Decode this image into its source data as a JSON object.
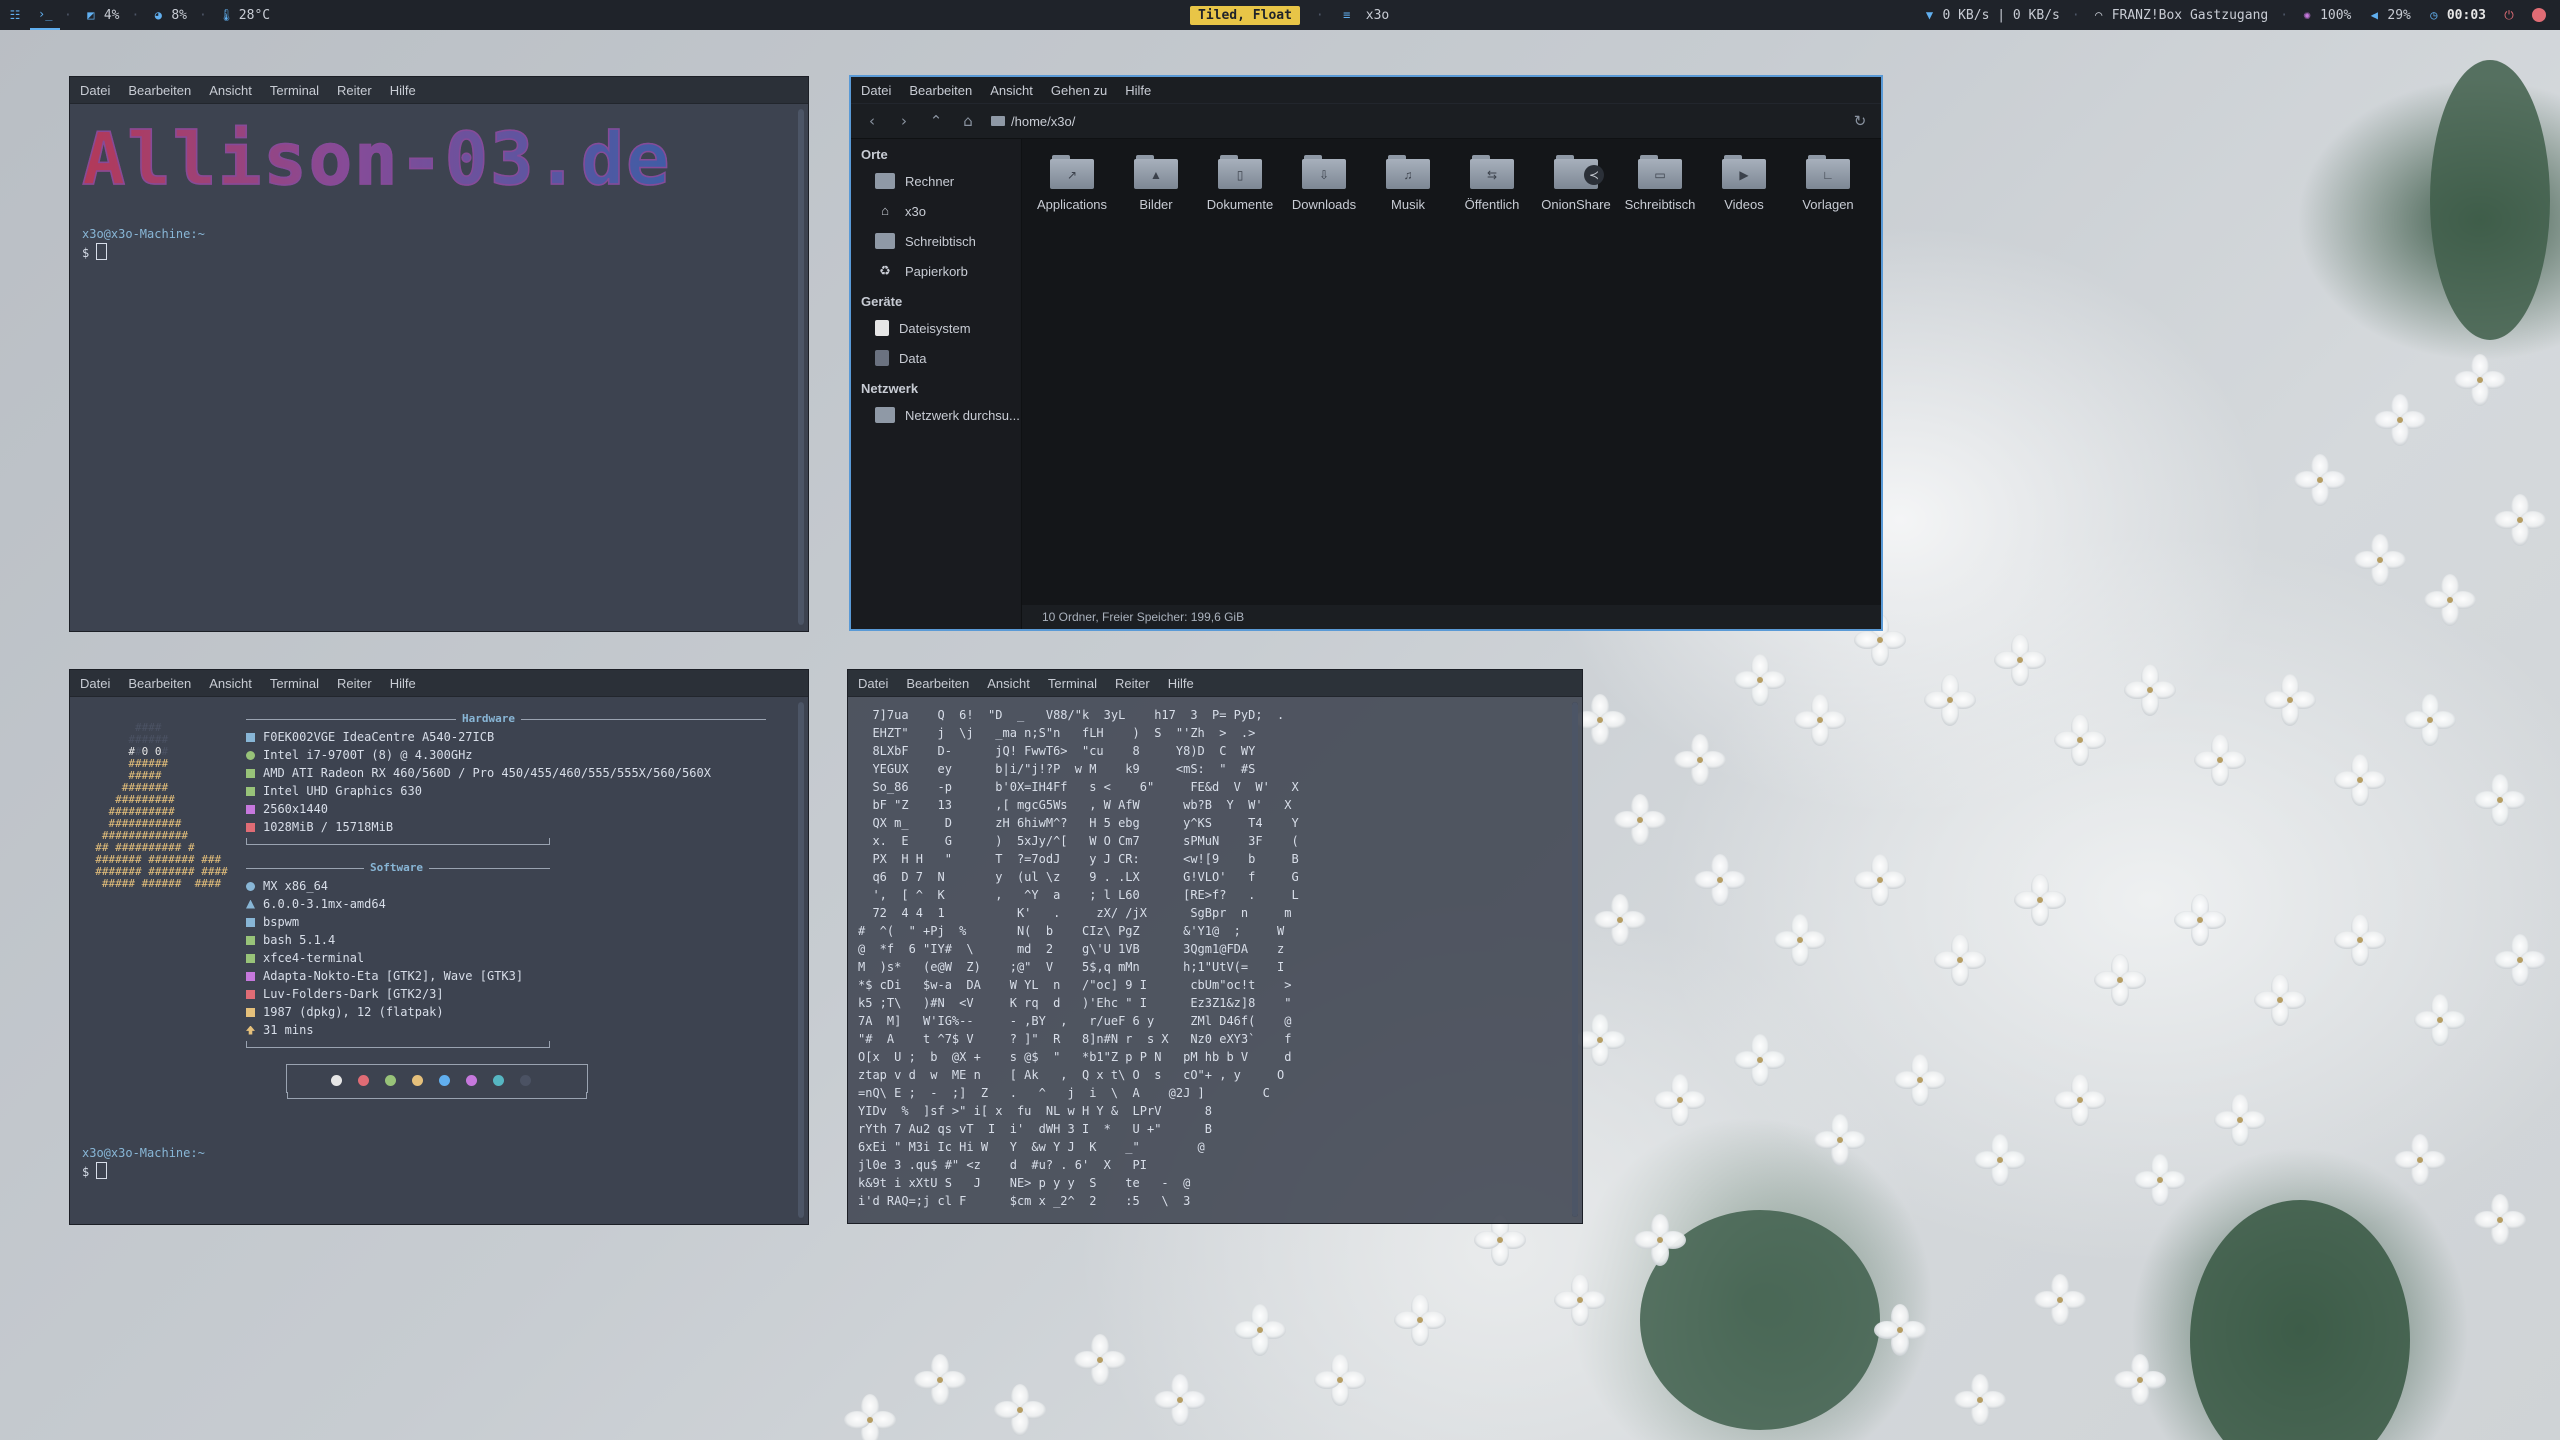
{
  "topbar": {
    "cpu": "4%",
    "ram": "8%",
    "temp": "28°C",
    "mode": "Tiled, Float",
    "window_title": "x3o",
    "net": "0 KB/s | 0 KB/s",
    "wifi": "FRANZ!Box Gastzugang",
    "brightness": "100%",
    "volume": "29%",
    "clock": "00:03"
  },
  "menu": [
    "Datei",
    "Bearbeiten",
    "Ansicht",
    "Terminal",
    "Reiter",
    "Hilfe"
  ],
  "fm_menu": [
    "Datei",
    "Bearbeiten",
    "Ansicht",
    "Gehen zu",
    "Hilfe"
  ],
  "term1": {
    "banner": "Allison-03.de",
    "prompt": "x3o@x3o-Machine:~",
    "ps": "$"
  },
  "filemanager": {
    "path": "/home/x3o/",
    "sections": [
      {
        "title": "Orte",
        "items": [
          "Rechner",
          "x3o",
          "Schreibtisch",
          "Papierkorb"
        ]
      },
      {
        "title": "Geräte",
        "items": [
          "Dateisystem",
          "Data"
        ]
      },
      {
        "title": "Netzwerk",
        "items": [
          "Netzwerk durchsu..."
        ]
      }
    ],
    "folders": [
      "Applications",
      "Bilder",
      "Dokumente",
      "Downloads",
      "Musik",
      "Öffentlich",
      "OnionShare",
      "Schreibtisch",
      "Videos",
      "Vorlagen"
    ],
    "status": "10 Ordner, Freier Speicher: 199,6 GiB"
  },
  "neofetch": {
    "hardware_title": "Hardware",
    "hardware": [
      "F0EK002VGE IdeaCentre A540-27ICB",
      "Intel i7-9700T (8) @ 4.300GHz",
      "AMD ATI Radeon RX 460/560D / Pro 450/455/460/555/555X/560/560X",
      "Intel UHD Graphics 630",
      "2560x1440",
      "1028MiB / 15718MiB"
    ],
    "software_title": "Software",
    "software": [
      "MX x86_64",
      "6.0.0-3.1mx-amd64",
      "bspwm",
      "bash 5.1.4",
      "xfce4-terminal",
      "Adapta-Nokto-Eta [GTK2], Wave [GTK3]",
      "Luv-Folders-Dark [GTK2/3]",
      "1987 (dpkg), 12 (flatpak)",
      "31 mins"
    ],
    "palette": [
      "#e6e6e6",
      "#e06c75",
      "#98c379",
      "#e5c07b",
      "#61afef",
      "#c678dd",
      "#56b6c2",
      "#4b5263"
    ],
    "prompt": "x3o@x3o-Machine:~",
    "ps": "$"
  },
  "matrix_lines": [
    "  7]7ua    Q  6!  \"D  _   V88/\"k  3yL    h17  3  P= PyD;  .",
    "  EHZT\"    j  \\j   _ma n;S\"n   fLH    )  S  \"'Zh  >  .>",
    "  8LXbF    D-      jQ! FwwT6>  \"cu    8     Y8)D  C  WY",
    "  YEGUX    ey      b|i/\"j!?P  w M    k9     <mS:  \"  #S",
    "  So_86    -p      b'0X=IH4Ff   s <    6\"     FE&d  V  W'   X",
    "  bF \"Z    13      ,[ mgcG5Ws   , W AfW      wb?B  Y  W'   X",
    "  QX m_     D      zH 6hiwM^?   H 5 ebg      y^KS     T4    Y",
    "  x.  E     G      )  5xJy/^[   W O Cm7      sPMuN    3F    (",
    "  PX  H H   \"      T  ?=7odJ    y J CR:      <w![9    b     B",
    "  q6  D 7  N       y  (ul \\z    9 . .LX      G!VLO'   f     G",
    "  ',  [ ^  K       ,   ^Y  a    ; l L60      [RE>f?   .     L",
    "  72  4 4  1          K'   .     zX/ /jX      SgBpr  n     m",
    "#  ^(  \" +Pj  %       N(  b    CIz\\ PgZ      &'Y1@  ;     W",
    "@  *f  6 \"IY#  \\      md  2    g\\'U 1VB      3Qgm1@FDA    z",
    "M  )s*   (e@W  Z)    ;@\"  V    5$,q mMn      h;1\"UtV(=    I",
    "*$ cDi   $w-a  DA    W YL  n   /\"oc] 9 I      cbUm\"oc!t    >",
    "k5 ;T\\   )#N  <V     K rq  d   )'Ehc \" I      Ez3Z1&z]8    \"",
    "7A  M]   W'IG%--     - ,BY  ,   r/ueF 6 y     ZMl D46f(    @",
    "\"#  A    t ^7$ V     ? ]\"  R   8]n#N r  s X   Nz0 eXY3`    f",
    "O[x  U ;  b  @X +    s @$  \"   *b1\"Z p P N   pM hb b V     d",
    "ztap v d  w  ME n    [ Ak   ,  Q x t\\ O  s   cO\"+ , y     O",
    "=nQ\\ E ;  -  ;]  Z   .   ^   j  i  \\  A    @2J ]        C",
    "YIDv  %  ]sf >\" i[ x  fu  NL w H Y &  LPrV      8",
    "rYth 7 Au2 qs vT  I  i'  dWH 3 I  *   U +\"      B",
    "6xEi \" M3i Ic Hi W   Y  &w Y J  K    _\"        @",
    "jl0e 3 .qu$ #\" <z    d  #u? . 6'  X   PI",
    "k&9t i xXtU S   J    NE> p y y  S    te   -  @",
    "i'd RAQ=;j cl F      $cm x _2^  2    :5   \\  3"
  ]
}
